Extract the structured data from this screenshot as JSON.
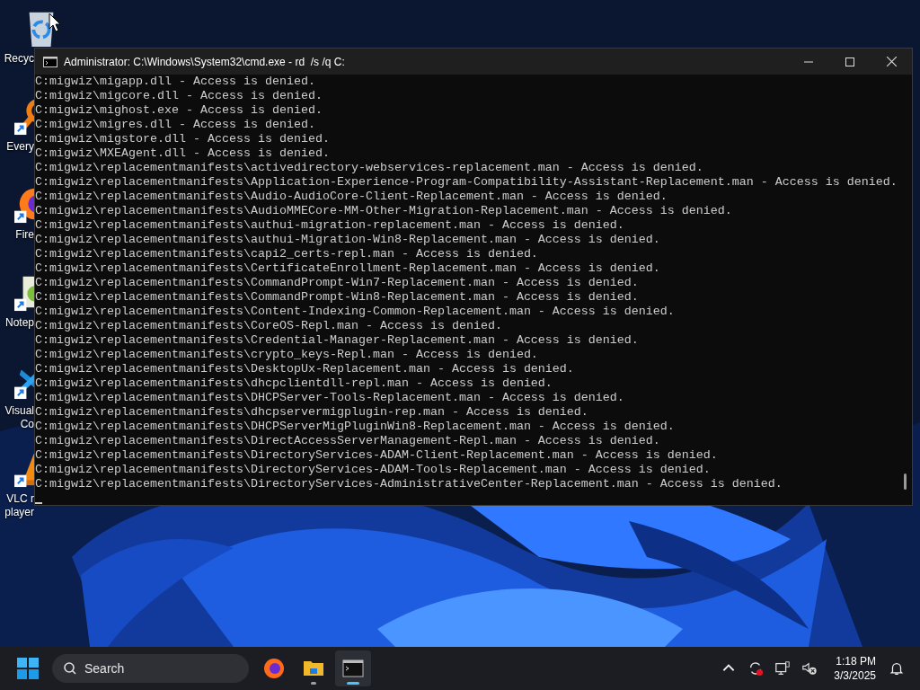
{
  "desktop": {
    "icons": [
      {
        "kind": "recycle-bin",
        "shortcut": false,
        "label_lines": [
          "Recyc"
        ]
      },
      {
        "kind": "search-app",
        "shortcut": true,
        "label_lines": [
          "Every"
        ]
      },
      {
        "kind": "firefox",
        "shortcut": true,
        "label_lines": [
          "Fire"
        ]
      },
      {
        "kind": "notepad",
        "shortcut": true,
        "label_lines": [
          "Notep"
        ]
      },
      {
        "kind": "code-editor",
        "shortcut": true,
        "label_lines": [
          "Visual",
          "Co"
        ]
      },
      {
        "kind": "vlc",
        "shortcut": true,
        "label_lines": [
          "VLC r",
          "player"
        ]
      }
    ]
  },
  "window": {
    "title": "Administrator: C:\\Windows\\System32\\cmd.exe - rd  /s /q C:",
    "lines": [
      "C:migwiz\\migapp.dll - Access is denied.",
      "C:migwiz\\migcore.dll - Access is denied.",
      "C:migwiz\\mighost.exe - Access is denied.",
      "C:migwiz\\migres.dll - Access is denied.",
      "C:migwiz\\migstore.dll - Access is denied.",
      "C:migwiz\\MXEAgent.dll - Access is denied.",
      "C:migwiz\\replacementmanifests\\activedirectory-webservices-replacement.man - Access is denied.",
      "C:migwiz\\replacementmanifests\\Application-Experience-Program-Compatibility-Assistant-Replacement.man - Access is denied.",
      "C:migwiz\\replacementmanifests\\Audio-AudioCore-Client-Replacement.man - Access is denied.",
      "C:migwiz\\replacementmanifests\\AudioMMECore-MM-Other-Migration-Replacement.man - Access is denied.",
      "C:migwiz\\replacementmanifests\\authui-migration-replacement.man - Access is denied.",
      "C:migwiz\\replacementmanifests\\authui-Migration-Win8-Replacement.man - Access is denied.",
      "C:migwiz\\replacementmanifests\\capi2_certs-repl.man - Access is denied.",
      "C:migwiz\\replacementmanifests\\CertificateEnrollment-Replacement.man - Access is denied.",
      "C:migwiz\\replacementmanifests\\CommandPrompt-Win7-Replacement.man - Access is denied.",
      "C:migwiz\\replacementmanifests\\CommandPrompt-Win8-Replacement.man - Access is denied.",
      "C:migwiz\\replacementmanifests\\Content-Indexing-Common-Replacement.man - Access is denied.",
      "C:migwiz\\replacementmanifests\\CoreOS-Repl.man - Access is denied.",
      "C:migwiz\\replacementmanifests\\Credential-Manager-Replacement.man - Access is denied.",
      "C:migwiz\\replacementmanifests\\crypto_keys-Repl.man - Access is denied.",
      "C:migwiz\\replacementmanifests\\DesktopUx-Replacement.man - Access is denied.",
      "C:migwiz\\replacementmanifests\\dhcpclientdll-repl.man - Access is denied.",
      "C:migwiz\\replacementmanifests\\DHCPServer-Tools-Replacement.man - Access is denied.",
      "C:migwiz\\replacementmanifests\\dhcpservermigplugin-rep.man - Access is denied.",
      "C:migwiz\\replacementmanifests\\DHCPServerMigPluginWin8-Replacement.man - Access is denied.",
      "C:migwiz\\replacementmanifests\\DirectAccessServerManagement-Repl.man - Access is denied.",
      "C:migwiz\\replacementmanifests\\DirectoryServices-ADAM-Client-Replacement.man - Access is denied.",
      "C:migwiz\\replacementmanifests\\DirectoryServices-ADAM-Tools-Replacement.man - Access is denied.",
      "C:migwiz\\replacementmanifests\\DirectoryServices-AdministrativeCenter-Replacement.man - Access is denied."
    ]
  },
  "taskbar": {
    "search": {
      "placeholder": "Search"
    },
    "apps": [
      {
        "kind": "firefox",
        "running": false,
        "selected": false
      },
      {
        "kind": "folder",
        "running": true,
        "selected": false
      },
      {
        "kind": "terminal",
        "running": true,
        "selected": true
      }
    ],
    "tray": {
      "sync_alert": true,
      "time": "1:18 PM",
      "date": "3/3/2025"
    }
  }
}
